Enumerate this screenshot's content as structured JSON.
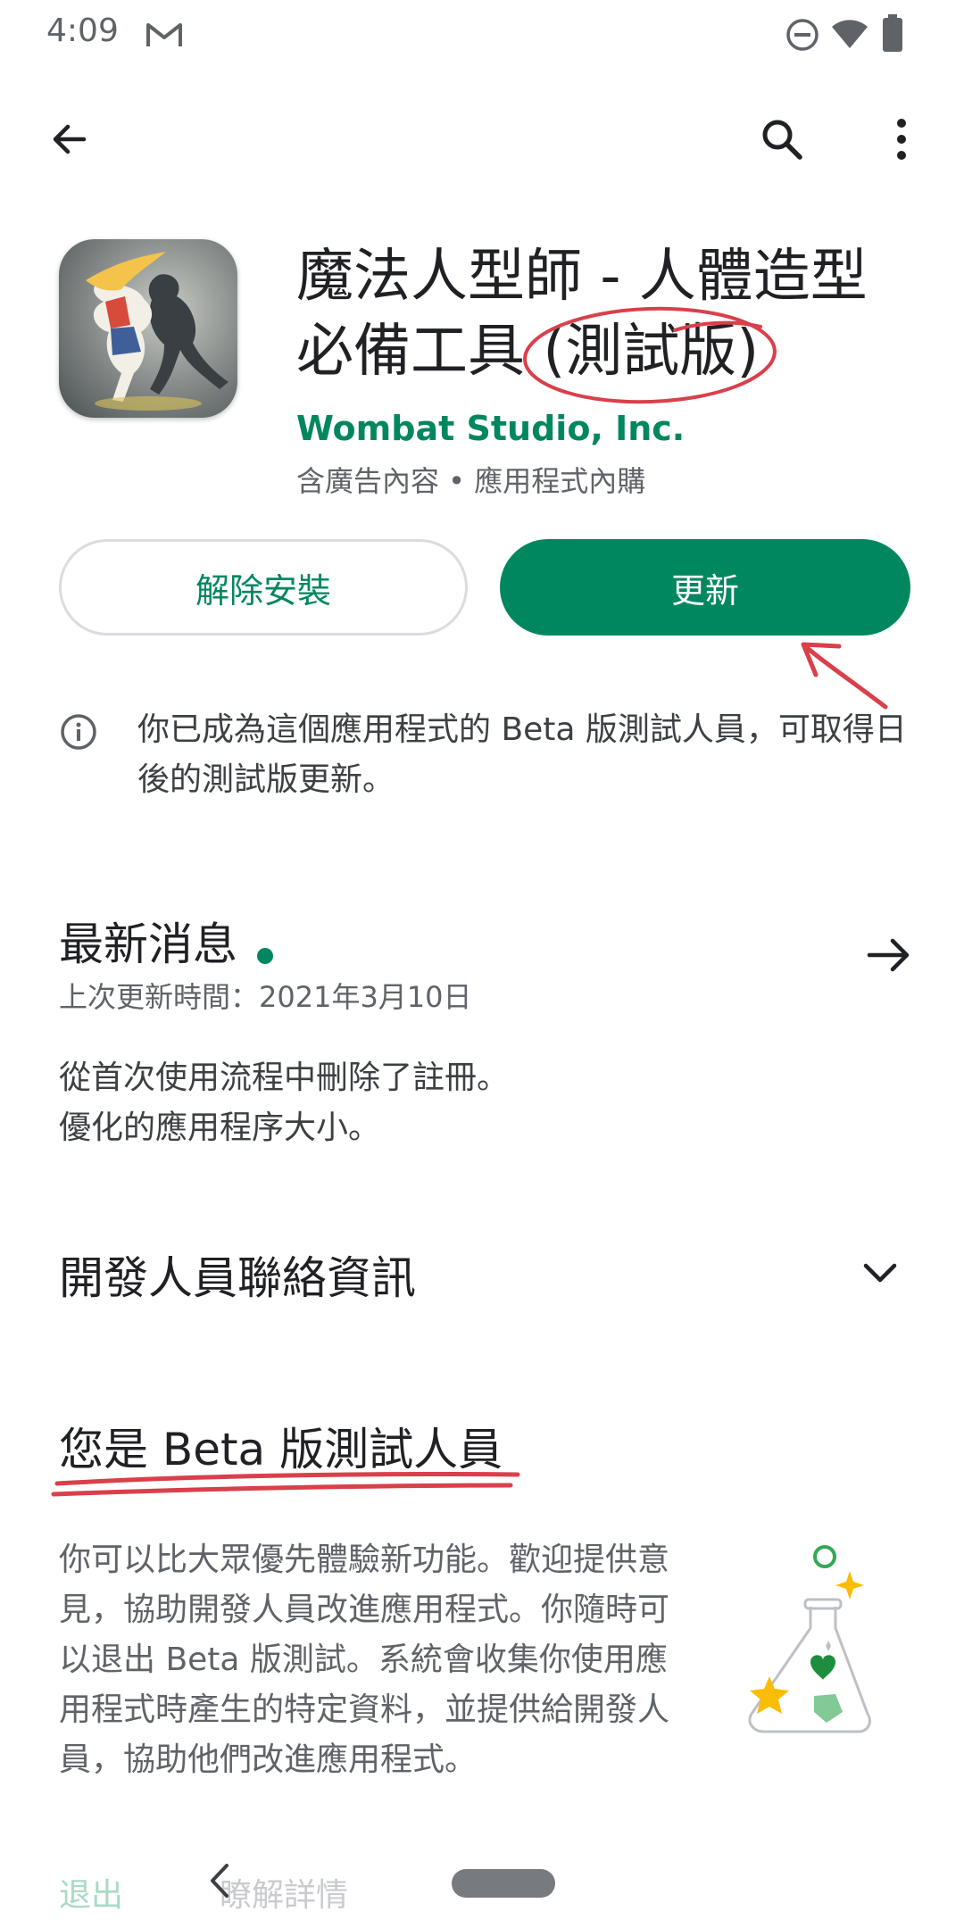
{
  "status_bar": {
    "time": "4:09"
  },
  "app_bar": {
    "icons": [
      "back-arrow-icon",
      "search-icon",
      "more-vert-icon"
    ]
  },
  "app": {
    "title": "魔法人型師 - 人體造型必備工具 (測試版)",
    "developer": "Wombat Studio, Inc.",
    "meta": "含廣告內容 • 應用程式內購"
  },
  "actions": {
    "uninstall_label": "解除安裝",
    "update_label": "更新"
  },
  "beta_notice": "你已成為這個應用程式的 Beta 版測試人員，可取得日後的測試版更新。",
  "whats_new": {
    "title": "最新消息",
    "updated": "上次更新時間：2021年3月10日",
    "notes": [
      "從首次使用流程中刪除了註冊。",
      "優化的應用程序大小。"
    ]
  },
  "developer_contact": {
    "title": "開發人員聯絡資訊"
  },
  "beta_section": {
    "title": "您是 Beta 版測試人員",
    "description": "你可以比大眾優先體驗新功能。歡迎提供意見，協助開發人員改進應用程式。你隨時可以退出 Beta 版測試。系統會收集你使用應用程式時產生的特定資料，並提供給開發人員，協助他們改進應用程式。",
    "leave_label": "退出",
    "learn_more_label": "瞭解詳情"
  },
  "colors": {
    "accent": "#01875f",
    "annotation": "#d9404a"
  }
}
